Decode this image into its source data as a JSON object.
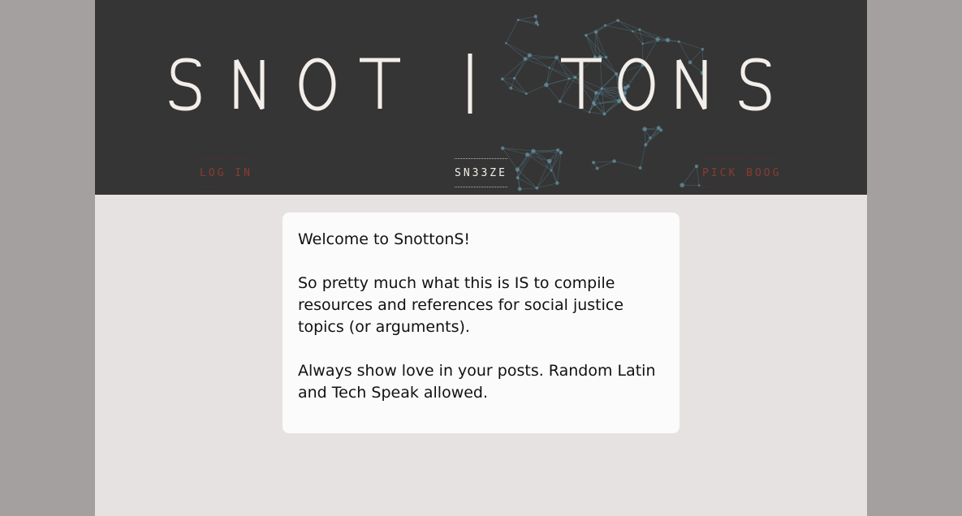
{
  "header": {
    "logo_text": "SNOT | TONS",
    "background_color": "#353535",
    "logo_color": "#f3eee9"
  },
  "nav": {
    "login_label": "LOG IN",
    "sneeze_label": "SN33ZE",
    "pick_label": "PICK BOOG",
    "inactive_color": "#8a3b31",
    "active_color": "#f3eee9"
  },
  "welcome": {
    "heading": "Welcome to SnottonS!",
    "paragraph_1": "So pretty much what this is IS to compile resources and references for social justice topics (or arguments).",
    "paragraph_2": "Always show love in your posts. Random Latin and Tech Speak allowed."
  }
}
